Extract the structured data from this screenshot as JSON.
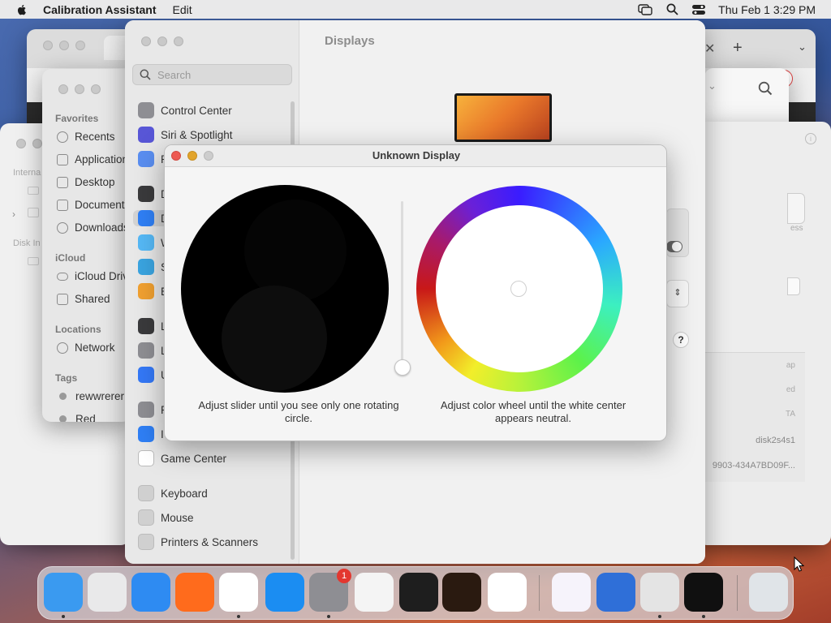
{
  "menubar": {
    "app_name": "Calibration Assistant",
    "menus": [
      "Edit"
    ],
    "clock": "Thu Feb 1  3:29 PM"
  },
  "finder": {
    "favorites_header": "Favorites",
    "favorites": [
      "Recents",
      "Applications",
      "Desktop",
      "Documents",
      "Downloads"
    ],
    "icloud_header": "iCloud",
    "icloud": [
      "iCloud Drive",
      "Shared"
    ],
    "locations_header": "Locations",
    "locations": [
      "Network"
    ],
    "tags_header": "Tags",
    "tags": [
      "rewwrerer",
      "Red"
    ]
  },
  "finder_back": {
    "internal": "Interna",
    "disk_images": "Disk In"
  },
  "disk_utility": {
    "ap": "ap",
    "ed": "ed",
    "ta": "TA",
    "device": "disk2s4s1",
    "uuid": "9903-434A7BD09F...",
    "ess": "ess"
  },
  "settings": {
    "title": "Displays",
    "search_placeholder": "Search",
    "sidebar": [
      {
        "label": "Control Center",
        "color": "#8e8e93",
        "icon": "control-center-icon"
      },
      {
        "label": "Siri & Spotlight",
        "color": "#5856d6",
        "icon": "siri-icon"
      },
      {
        "label": "P",
        "color": "#5a8ef0",
        "icon": "privacy-icon"
      },
      {
        "label": "D",
        "color": "#3a3a3c",
        "icon": "desktop-dock-icon"
      },
      {
        "label": "D",
        "color": "#2f7ff5",
        "icon": "displays-icon"
      },
      {
        "label": "W",
        "color": "#55b8f5",
        "icon": "wallpaper-icon"
      },
      {
        "label": "S",
        "color": "#3aa4e0",
        "icon": "screensaver-icon"
      },
      {
        "label": "E",
        "color": "#f0a030",
        "icon": "energy-icon"
      },
      {
        "label": "L",
        "color": "#3a3a3c",
        "icon": "lock-screen-icon"
      },
      {
        "label": "L",
        "color": "#8e8e93",
        "icon": "login-password-icon"
      },
      {
        "label": "U",
        "color": "#3478f6",
        "icon": "users-groups-icon"
      },
      {
        "label": "P",
        "color": "#8e8e93",
        "icon": "passwords-icon"
      },
      {
        "label": "I",
        "color": "#2f7ff5",
        "icon": "internet-accounts-icon"
      },
      {
        "label": "Game Center",
        "color": "#ffffff",
        "icon": "game-center-icon"
      },
      {
        "label": "Keyboard",
        "color": "#d0d0d0",
        "icon": "keyboard-icon"
      },
      {
        "label": "Mouse",
        "color": "#d0d0d0",
        "icon": "mouse-icon"
      },
      {
        "label": "Printers & Scanners",
        "color": "#d0d0d0",
        "icon": "printer-icon"
      }
    ],
    "help_label": "?"
  },
  "dialog": {
    "title": "Unknown Display",
    "left_caption": "Adjust slider until you see only one rotating circle.",
    "right_caption": "Adjust color wheel until the white center appears neutral.",
    "slider_value": 0.0
  },
  "dock": {
    "apps": [
      {
        "name": "Finder",
        "color": "#3a9af0",
        "icon": "finder-icon",
        "running": true
      },
      {
        "name": "Launchpad",
        "color": "#e9e9ea",
        "icon": "launchpad-icon",
        "running": false
      },
      {
        "name": "Safari",
        "color": "#2e8bf2",
        "icon": "safari-icon",
        "running": false
      },
      {
        "name": "Firefox",
        "color": "#ff6b1c",
        "icon": "firefox-icon",
        "running": false
      },
      {
        "name": "Chrome",
        "color": "#ffffff",
        "icon": "chrome-icon",
        "running": true
      },
      {
        "name": "App Store",
        "color": "#1b8df2",
        "icon": "app-store-icon",
        "running": false
      },
      {
        "name": "System Settings",
        "color": "#8e8e93",
        "icon": "system-settings-icon",
        "running": true,
        "badge": "1"
      },
      {
        "name": "TextEdit",
        "color": "#f4f4f4",
        "icon": "textedit-icon",
        "running": false
      },
      {
        "name": "Terminal",
        "color": "#1e1e1e",
        "icon": "terminal-icon",
        "running": false
      },
      {
        "name": "GarageBand",
        "color": "#2a1a10",
        "icon": "garageband-icon",
        "running": false
      },
      {
        "name": "Visual Studio Code",
        "color": "#ffffff",
        "icon": "vscode-icon",
        "running": false
      },
      {
        "name": "Visual Studio",
        "color": "#f6f3fb",
        "icon": "visual-studio-icon",
        "running": false
      },
      {
        "name": "iCloud",
        "color": "#2f6fd8",
        "icon": "icloud-icon",
        "running": false
      },
      {
        "name": "Disk Utility",
        "color": "#e4e4e4",
        "icon": "disk-utility-icon",
        "running": true
      },
      {
        "name": "Calibration Assistant",
        "color": "#101010",
        "icon": "calibration-icon",
        "running": true
      },
      {
        "name": "Trash",
        "color": "#e0e4e8",
        "icon": "trash-icon",
        "running": false
      }
    ]
  }
}
